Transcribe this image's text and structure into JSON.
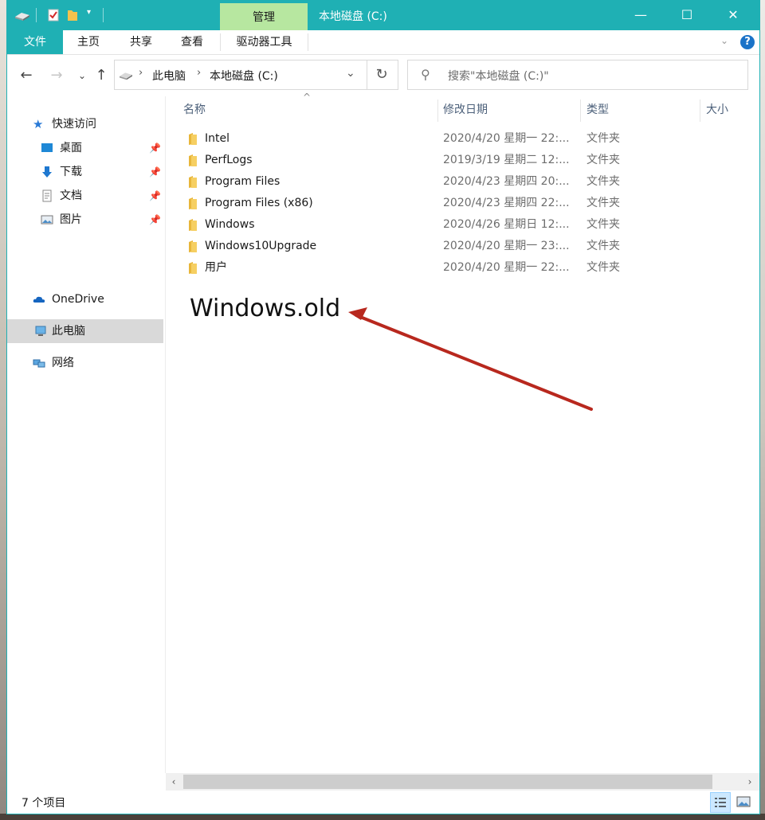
{
  "window": {
    "title": "本地磁盘 (C:)",
    "context_tab": "管理",
    "accent_color": "#1fb0b4",
    "caption_buttons": {
      "minimize": "—",
      "maximize": "☐",
      "close": "✕"
    }
  },
  "ribbon": {
    "tabs": [
      "文件",
      "主页",
      "共享",
      "查看",
      "驱动器工具"
    ]
  },
  "address_bar": {
    "crumbs": [
      "此电脑",
      "本地磁盘 (C:)"
    ]
  },
  "search": {
    "placeholder": "搜索\"本地磁盘 (C:)\""
  },
  "sidebar": {
    "quick_access": "快速访问",
    "pinned": [
      "桌面",
      "下载",
      "文档",
      "图片"
    ],
    "onedrive": "OneDrive",
    "this_pc": "此电脑",
    "network": "网络"
  },
  "file_list": {
    "columns": {
      "name": "名称",
      "date": "修改日期",
      "type": "类型",
      "size": "大小"
    },
    "rows": [
      {
        "name": "Intel",
        "date": "2020/4/20 星期一 22:...",
        "type": "文件夹"
      },
      {
        "name": "PerfLogs",
        "date": "2019/3/19 星期二 12:...",
        "type": "文件夹"
      },
      {
        "name": "Program Files",
        "date": "2020/4/23 星期四 20:...",
        "type": "文件夹"
      },
      {
        "name": "Program Files (x86)",
        "date": "2020/4/23 星期四 22:...",
        "type": "文件夹"
      },
      {
        "name": "Windows",
        "date": "2020/4/26 星期日 12:...",
        "type": "文件夹"
      },
      {
        "name": "Windows10Upgrade",
        "date": "2020/4/20 星期一 23:...",
        "type": "文件夹"
      },
      {
        "name": "用户",
        "date": "2020/4/20 星期一 22:...",
        "type": "文件夹"
      }
    ]
  },
  "annotation": {
    "text": "Windows.old",
    "arrow_color": "#b8281e"
  },
  "status": {
    "item_count": "7 个项目"
  }
}
